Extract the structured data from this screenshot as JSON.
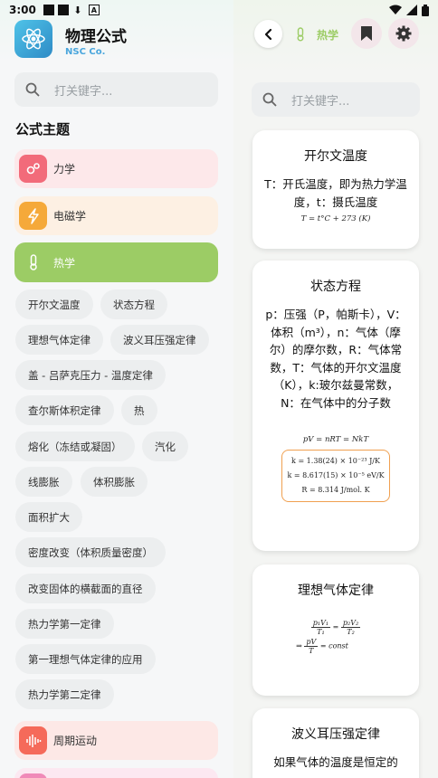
{
  "status": {
    "time": "3:00"
  },
  "app": {
    "name": "物理公式",
    "company": "NSC Co."
  },
  "sidebar": {
    "search_placeholder": "打关键字...",
    "section_title": "公式主题",
    "topics": [
      {
        "label": "力学",
        "icon": "gears-icon",
        "bg": "#fde8ea",
        "icon_bg": "#f26b7a"
      },
      {
        "label": "电磁学",
        "icon": "lightning-icon",
        "bg": "#fdf0e3",
        "icon_bg": "#f5a93a"
      },
      {
        "label": "热学",
        "icon": "thermometer-icon",
        "bg": "#9ccc65",
        "icon_bg": "#9ccc65"
      },
      {
        "label": "周期运动",
        "icon": "sound-wave-icon",
        "bg": "#fde8e6",
        "icon_bg": "#f56a5a"
      }
    ],
    "subtopics": [
      "开尔文温度",
      "状态方程",
      "理想气体定律",
      "波义耳压强定律",
      "盖 - 吕萨克压力 - 温度定律",
      "查尔斯体积定律",
      "热",
      "熔化（冻结或凝固）",
      "汽化",
      "线膨胀",
      "体积膨胀",
      "面积扩大",
      "密度改变（体积质量密度）",
      "改变固体的横截面的直径",
      "热力学第一定律",
      "第一理想气体定律的应用",
      "热力学第二定律"
    ]
  },
  "header": {
    "title": "热学",
    "accent": "#9ccc65"
  },
  "main": {
    "search_placeholder": "打关键字...",
    "cards": [
      {
        "title": "开尔文温度",
        "desc": "T：开氏温度，即为热力学温度，t：摄氏温度",
        "formula": "T = t°C + 273 (K)"
      },
      {
        "title": "状态方程",
        "desc": "p：压强（P，帕斯卡），V：体积（m³），n：气体（摩尔）的摩尔数，R：气体常数，T：气体的开尔文温度（K），k:玻尔兹曼常数，N：在气体中的分子数",
        "formula": "pV = nRT = NkT",
        "constants": [
          "k = 1.38(24) × 10⁻²³ J/K",
          "k = 8.617(15) × 10⁻⁵ eV/K",
          "R = 8.314 J/mol. K"
        ]
      },
      {
        "title": "理想气体定律",
        "formula_n1": "p₁V₁",
        "formula_d1": "T₁",
        "formula_n2": "p₂V₂",
        "formula_d2": "T₂",
        "formula_implies": "⇒",
        "formula_n3": "pV",
        "formula_d3": "T",
        "formula_const": "= const"
      },
      {
        "title": "波义耳压强定律",
        "desc": "如果气体的温度是恒定的"
      }
    ]
  }
}
